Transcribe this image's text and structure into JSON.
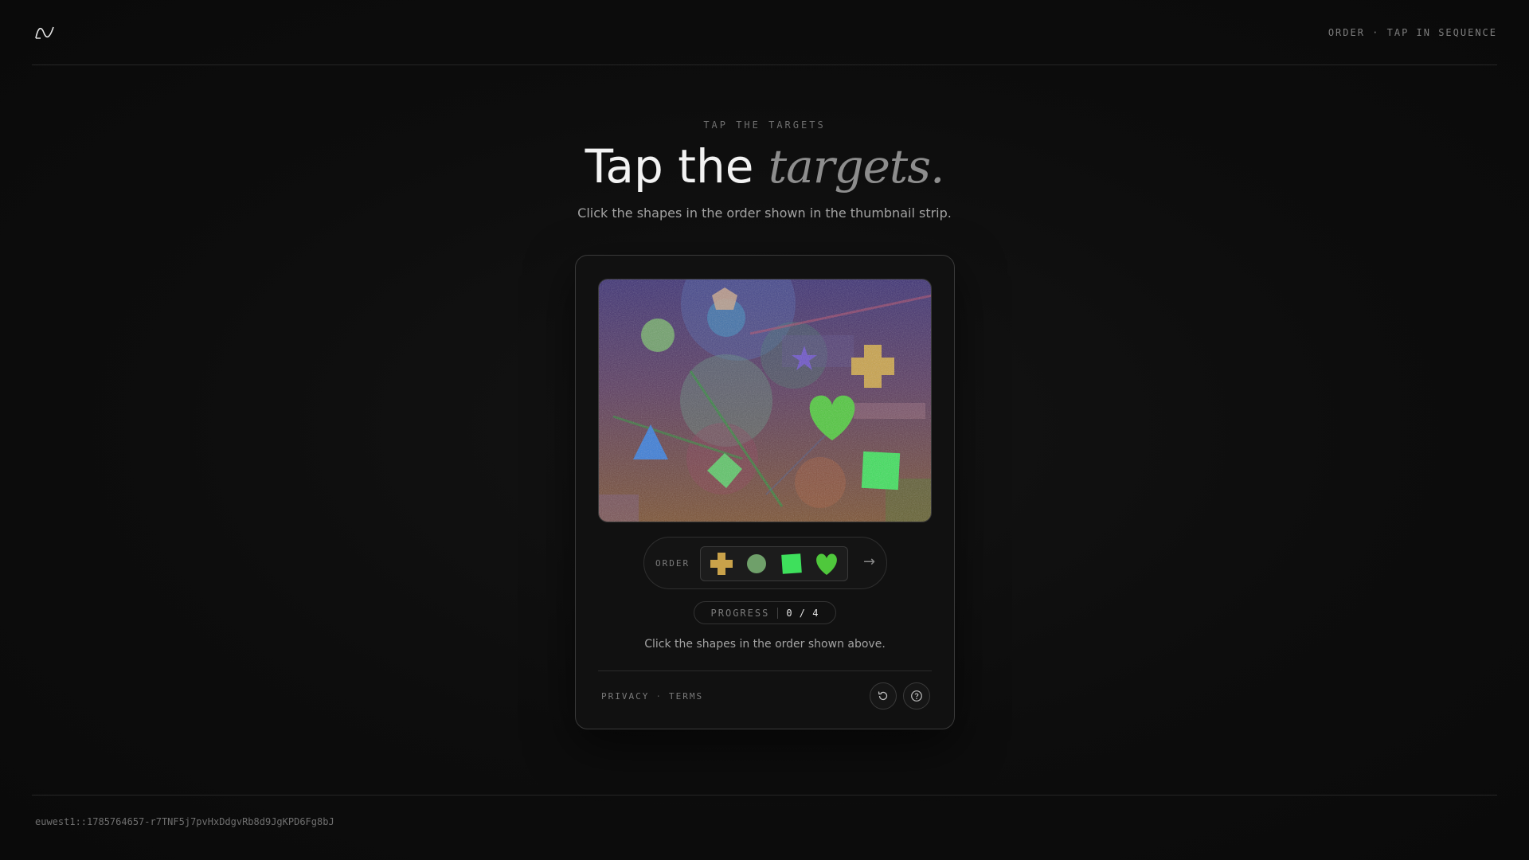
{
  "header": {
    "logo_icon": "wave-logo-icon",
    "mode_label": "ORDER · TAP IN SEQUENCE"
  },
  "hero": {
    "eyebrow": "TAP THE TARGETS",
    "title_main": "Tap the ",
    "title_accent": "targets.",
    "subtitle": "Click the shapes in the order shown in the thumbnail strip."
  },
  "challenge": {
    "order_label": "ORDER",
    "order_sequence": [
      {
        "shape": "cross",
        "color": "#c9a24a"
      },
      {
        "shape": "circle",
        "color": "#6fa06a"
      },
      {
        "shape": "square",
        "color": "#3ee05c"
      },
      {
        "shape": "heart",
        "color": "#4fc83c"
      }
    ],
    "arrow_icon": "arrow-right-icon",
    "progress_label": "PROGRESS",
    "progress_value": "0 / 4",
    "progress_current": 0,
    "progress_total": 4,
    "hint": "Click the shapes in the order shown above.",
    "footer": {
      "privacy": "PRIVACY",
      "separator": "·",
      "terms": "TERMS",
      "refresh_icon": "refresh-icon",
      "help_icon": "help-icon"
    }
  },
  "session_id": "euwest1::1785764657-r7TNF5j7pvHxDdgvRb8d9JgKPD6Fg8bJ"
}
